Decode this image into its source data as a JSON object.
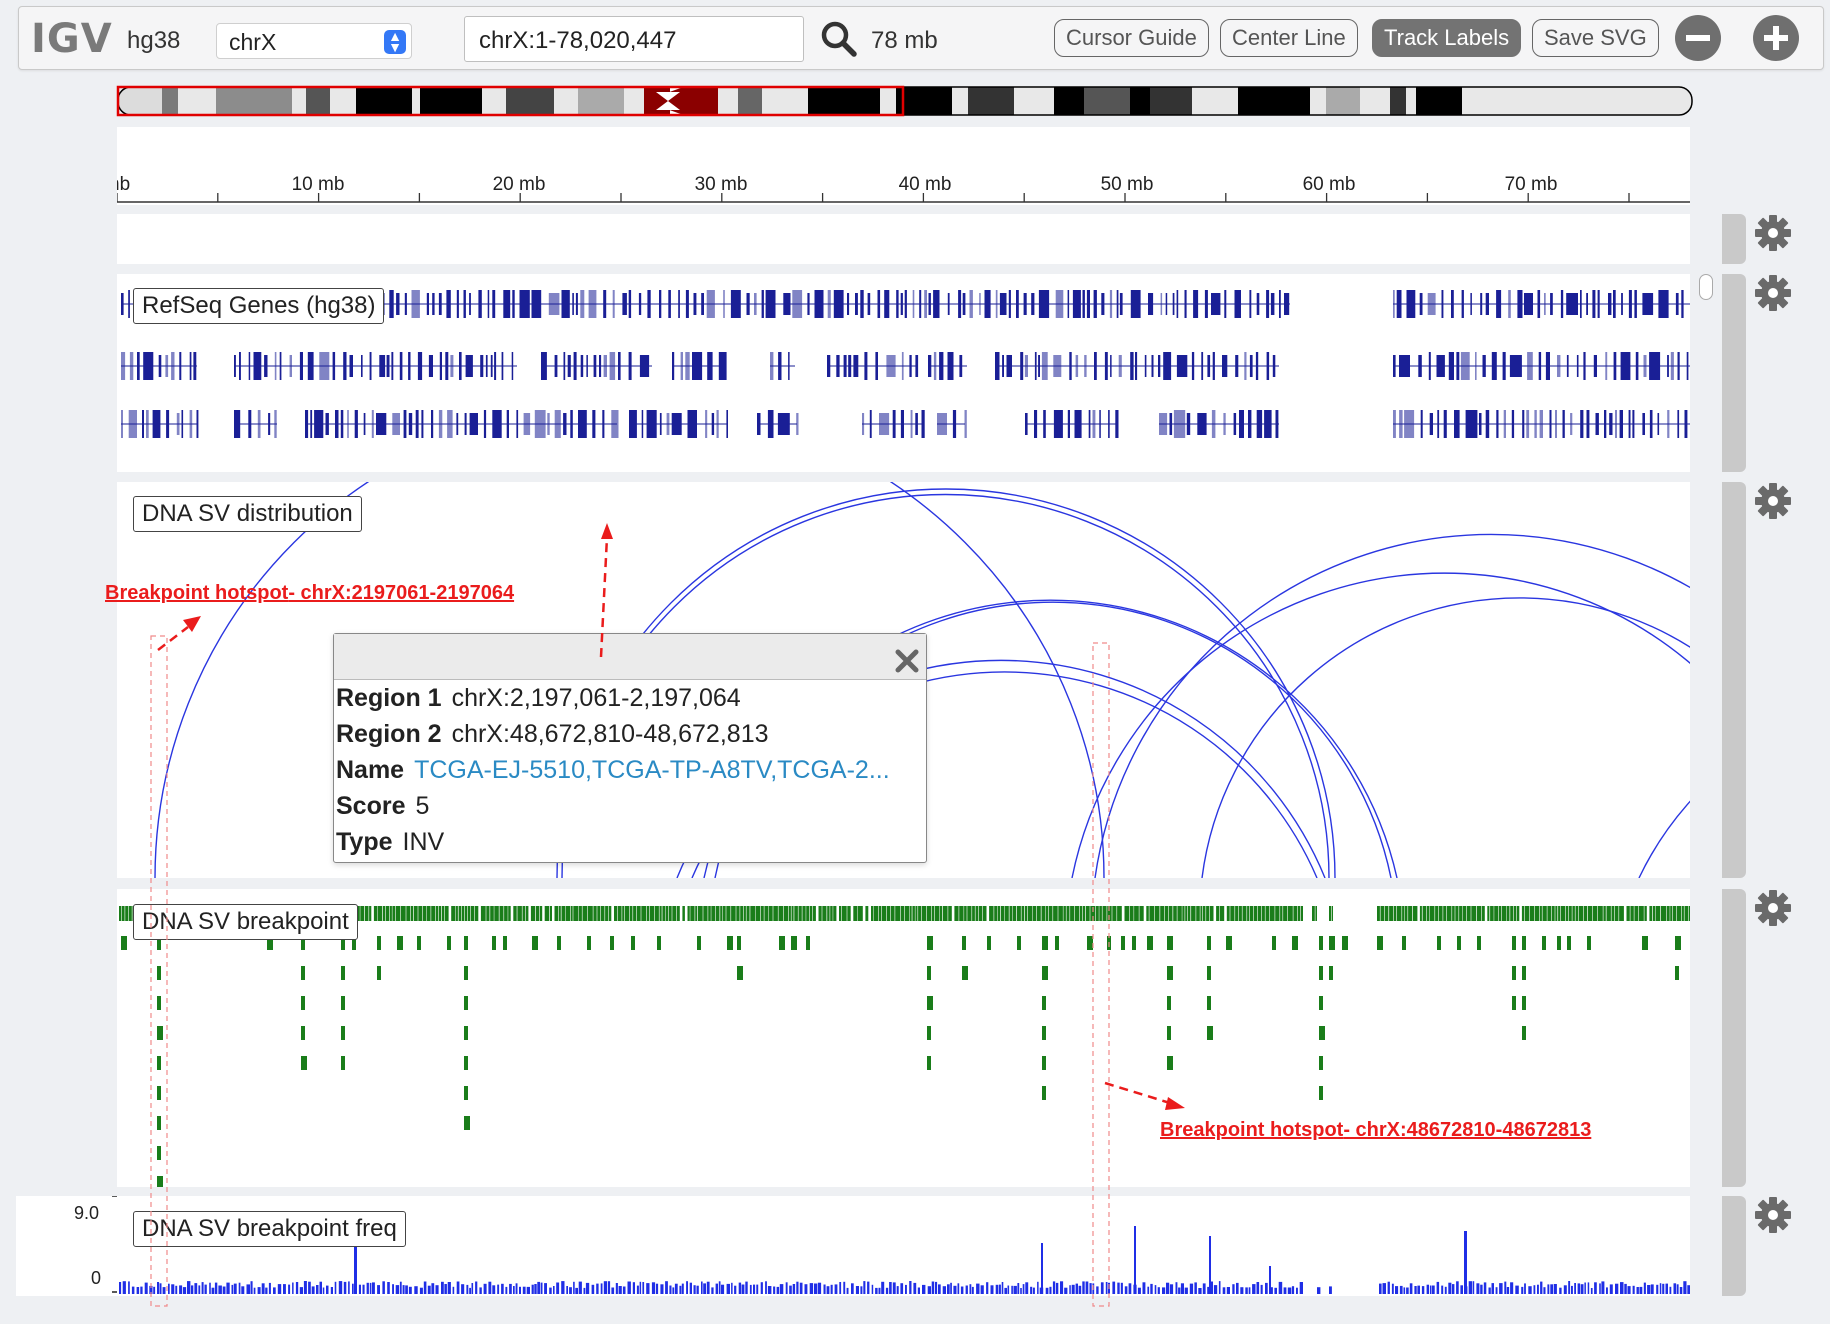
{
  "navbar": {
    "logo": "IGV",
    "genome": "hg38",
    "chromosome": "chrX",
    "locus": "chrX:1-78,020,447",
    "window_size": "78 mb",
    "buttons": {
      "cursor_guide": "Cursor Guide",
      "center_line": "Center Line",
      "track_labels": "Track Labels",
      "save_svg": "Save SVG"
    }
  },
  "ruler": {
    "ticks": [
      "mb",
      "10 mb",
      "20 mb",
      "30 mb",
      "40 mb",
      "50 mb",
      "60 mb",
      "70 mb"
    ]
  },
  "tracks": {
    "genes": {
      "label": "RefSeq Genes (hg38)"
    },
    "sv_distribution": {
      "label": "DNA SV distribution"
    },
    "sv_breakpoint": {
      "label": "DNA SV breakpoint"
    },
    "sv_freq": {
      "label": "DNA SV breakpoint freq",
      "axis_max": "9.0",
      "axis_min": "0"
    }
  },
  "popup": {
    "rows": [
      {
        "key": "Region 1",
        "value": "chrX:2,197,061-2,197,064"
      },
      {
        "key": "Region 2",
        "value": "chrX:48,672,810-48,672,813"
      },
      {
        "key": "Name",
        "value": "TCGA-EJ-5510,TCGA-TP-A8TV,TCGA-2..."
      },
      {
        "key": "Score",
        "value": "5"
      },
      {
        "key": "Type",
        "value": "INV"
      }
    ]
  },
  "annotations": {
    "hotspot1": {
      "title": "Breakpoint hotspot",
      "locus": "- chrX:2197061-2197064"
    },
    "hotspot2": {
      "title": "Breakpoint hotspot",
      "locus": "- chrX:48672810-48672813"
    }
  },
  "colors": {
    "gene": "#1a1f96",
    "sv_arc": "#2a36e0",
    "breakpoint": "#1a7d1a",
    "freq_bar": "#1f2ee6",
    "annotation": "#ea1c1c",
    "active_button": "#737373"
  },
  "icons": [
    "search-icon",
    "zoom-out-icon",
    "zoom-in-icon",
    "gear-icon",
    "close-icon"
  ]
}
